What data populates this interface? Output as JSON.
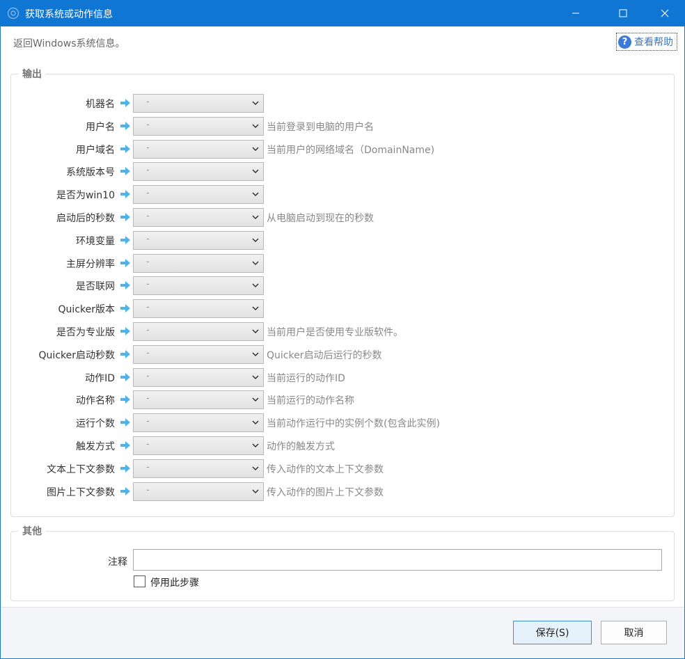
{
  "window": {
    "title": "获取系统或动作信息",
    "description": "返回Windows系统信息。",
    "help_label": "查看帮助",
    "help_icon_glyph": "?"
  },
  "output": {
    "title": "输出",
    "rows": [
      {
        "label": "机器名",
        "value": "-",
        "hint": ""
      },
      {
        "label": "用户名",
        "value": "-",
        "hint": "当前登录到电脑的用户名"
      },
      {
        "label": "用户域名",
        "value": "-",
        "hint": "当前用户的网络域名（DomainName)"
      },
      {
        "label": "系统版本号",
        "value": "-",
        "hint": ""
      },
      {
        "label": "是否为win10",
        "value": "-",
        "hint": ""
      },
      {
        "label": "启动后的秒数",
        "value": "-",
        "hint": "从电脑启动到现在的秒数"
      },
      {
        "label": "环境变量",
        "value": "-",
        "hint": ""
      },
      {
        "label": "主屏分辨率",
        "value": "-",
        "hint": ""
      },
      {
        "label": "是否联网",
        "value": "-",
        "hint": ""
      },
      {
        "label": "Quicker版本",
        "value": "-",
        "hint": ""
      },
      {
        "label": "是否为专业版",
        "value": "-",
        "hint": "当前用户是否使用专业版软件。"
      },
      {
        "label": "Quicker启动秒数",
        "value": "-",
        "hint": "Quicker启动后运行的秒数"
      },
      {
        "label": "动作ID",
        "value": "-",
        "hint": "当前运行的动作ID"
      },
      {
        "label": "动作名称",
        "value": "-",
        "hint": "当前运行的动作名称"
      },
      {
        "label": "运行个数",
        "value": "-",
        "hint": "当前动作运行中的实例个数(包含此实例)"
      },
      {
        "label": "触发方式",
        "value": "-",
        "hint": "动作的触发方式"
      },
      {
        "label": "文本上下文参数",
        "value": "-",
        "hint": "传入动作的文本上下文参数"
      },
      {
        "label": "图片上下文参数",
        "value": "-",
        "hint": "传入动作的图片上下文参数"
      }
    ]
  },
  "other": {
    "title": "其他",
    "note_label": "注释",
    "note_value": "",
    "disable_label": "停用此步骤",
    "disable_checked": false
  },
  "footer": {
    "save_label": "保存(S)",
    "cancel_label": "取消"
  },
  "colors": {
    "titlebar": "#0f76d3",
    "arrow": "#4fb3ea",
    "help_icon": "#3a7ad8"
  }
}
